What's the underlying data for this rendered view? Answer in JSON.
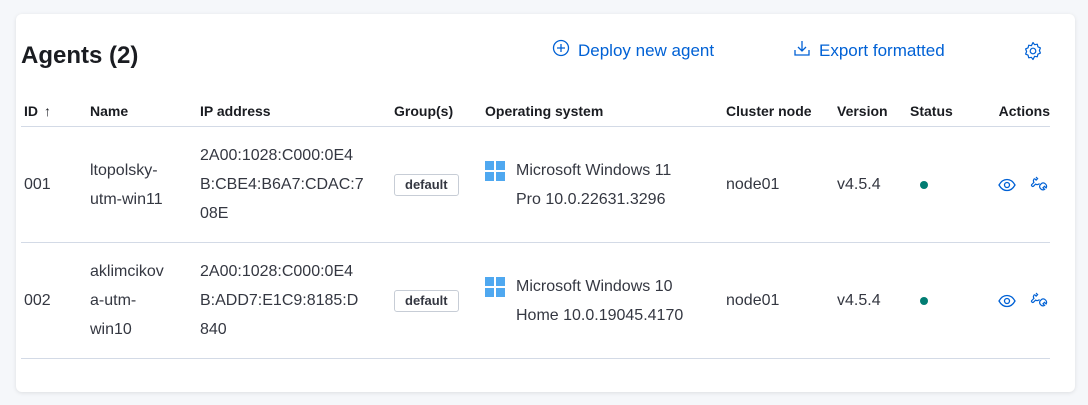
{
  "header": {
    "title": "Agents (2)",
    "deploy_label": "Deploy new agent",
    "export_label": "Export formatted",
    "accent_color": "#0061d5"
  },
  "table": {
    "columns": {
      "id": "ID",
      "name": "Name",
      "ip": "IP address",
      "groups": "Group(s)",
      "os": "Operating system",
      "cluster": "Cluster node",
      "version": "Version",
      "status": "Status",
      "actions": "Actions"
    },
    "sort_indicator": "↑",
    "rows": [
      {
        "id": "001",
        "name_lines": [
          "ltopolsky-",
          "utm-win11"
        ],
        "ip_lines": [
          "2A00:1028:C000:0E4",
          "B:CBE4:B6A7:CDAC:7",
          "08E"
        ],
        "group": "default",
        "os_lines": [
          "Microsoft Windows 11",
          "Pro 10.0.22631.3296"
        ],
        "os_icon": "windows-icon",
        "cluster": "node01",
        "version": "v4.5.4",
        "status_color": "#017d73"
      },
      {
        "id": "002",
        "name_lines": [
          "aklimcikov",
          "a-utm-",
          "win10"
        ],
        "ip_lines": [
          "2A00:1028:C000:0E4",
          "B:ADD7:E1C9:8185:D",
          "840"
        ],
        "group": "default",
        "os_lines": [
          "Microsoft Windows 10",
          "Home 10.0.19045.4170"
        ],
        "os_icon": "windows-icon",
        "cluster": "node01",
        "version": "v4.5.4",
        "status_color": "#017d73"
      }
    ]
  }
}
